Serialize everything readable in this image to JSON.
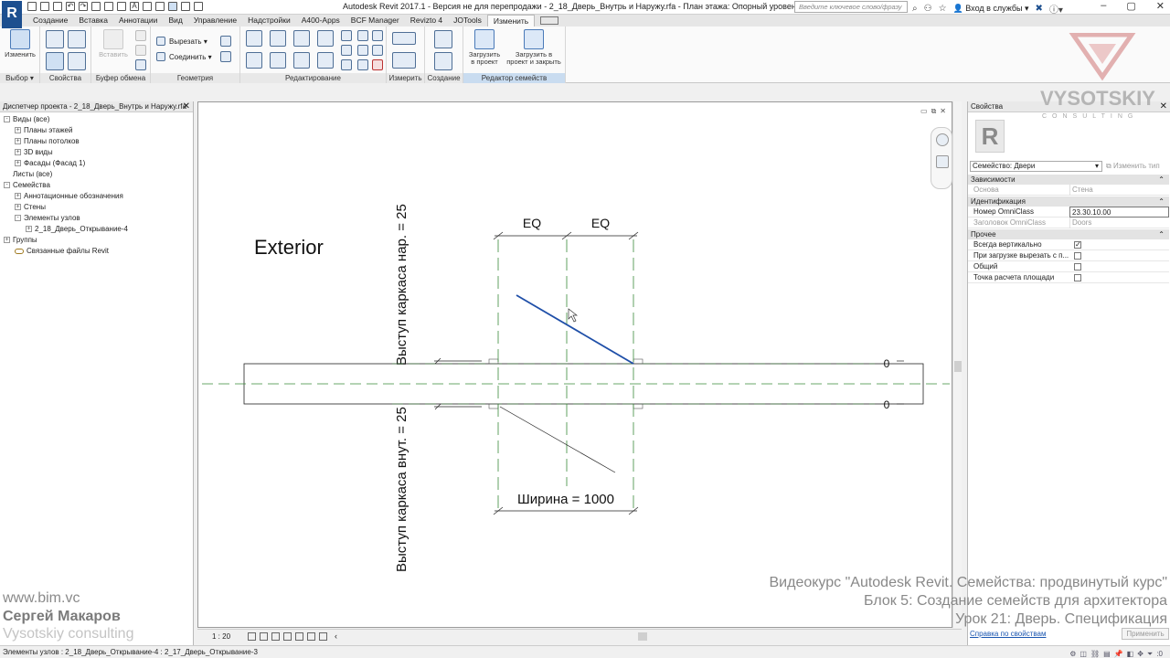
{
  "titlebar": {
    "app_title": "Autodesk Revit 2017.1 - Версия не для перепродажи -    2_18_Дверь_Внутрь и Наружу.rfa - План этажа: Опорный уровень",
    "search_placeholder": "Введите ключевое слово/фразу",
    "signin": "Вход в службы",
    "logo": "R"
  },
  "tabs": [
    "Создание",
    "Вставка",
    "Аннотации",
    "Вид",
    "Управление",
    "Надстройки",
    "A400-Apps",
    "BCF Manager",
    "Revizto 4",
    "JOTools",
    "Изменить"
  ],
  "active_tab": "Изменить",
  "ribbon": {
    "modify_label": "Изменить",
    "paste_label": "Вставить",
    "cut_label": "Вырезать",
    "join_label": "Соединить",
    "load_project_label": "Загрузить в проект",
    "load_close_label": "Загрузить в проект и закрыть",
    "groups": {
      "select": "Выбор",
      "properties": "Свойства",
      "clipboard": "Буфер обмена",
      "geometry": "Геометрия",
      "modify": "Редактирование",
      "measure": "Измерить",
      "create": "Создание",
      "family_editor": "Редактор семейств"
    }
  },
  "project_browser": {
    "title": "Диспетчер проекта - 2_18_Дверь_Внутрь и Наружу.rfa",
    "items": [
      {
        "label": "Виды (все)",
        "toggle": "-"
      },
      {
        "label": "Планы этажей",
        "toggle": "+"
      },
      {
        "label": "Планы потолков",
        "toggle": "+"
      },
      {
        "label": "3D виды",
        "toggle": "+"
      },
      {
        "label": "Фасады (Фасад 1)",
        "toggle": "+"
      },
      {
        "label": "Листы (все)",
        "toggle": ""
      },
      {
        "label": "Семейства",
        "toggle": "-"
      },
      {
        "label": "Аннотационные обозначения",
        "toggle": "+"
      },
      {
        "label": "Стены",
        "toggle": "+"
      },
      {
        "label": "Элементы узлов",
        "toggle": "-"
      },
      {
        "label": "2_18_Дверь_Открывание-4",
        "toggle": "+"
      },
      {
        "label": "Группы",
        "toggle": "+"
      },
      {
        "label": "Связанные файлы Revit",
        "toggle": ""
      }
    ]
  },
  "drawing": {
    "exterior_label": "Exterior",
    "eq_left": "EQ",
    "eq_right": "EQ",
    "width_dim": "Ширина = 1000",
    "frame_out_dim": "Выступ каркаса нар. = 25",
    "frame_in_dim": "Выступ каркаса внут. = 25",
    "zero_top": "0",
    "zero_bottom": "0"
  },
  "view_bar": {
    "scale": "1 : 20"
  },
  "properties": {
    "title": "Свойства",
    "thumb": "R",
    "family": "Семейство: Двери",
    "edit_type": "Изменить тип",
    "categories": {
      "constraints": "Зависимости",
      "identity": "Идентификация",
      "other": "Прочее"
    },
    "host_key": "Основа",
    "host_value": "Стена",
    "omni_num_key": "Номер OmniClass",
    "omni_num_value": "23.30.10.00",
    "omni_title_key": "Заголовок OmniClass",
    "omni_title_value": "Doors",
    "checks": [
      {
        "label": "Всегда вертикально",
        "checked": true
      },
      {
        "label": "При загрузке вырезать с п...",
        "checked": false
      },
      {
        "label": "Общий",
        "checked": false
      },
      {
        "label": "Точка расчета площади",
        "checked": false
      }
    ],
    "help_link": "Справка по свойствам",
    "apply": "Применить"
  },
  "status": {
    "text": "Элементы узлов : 2_18_Дверь_Открывание-4 : 2_17_Дверь_Открывание-3",
    "zero": ":0"
  },
  "watermark": {
    "brand": "VYSOTSKIY",
    "sub": "CONSULTING"
  },
  "course_overlay": {
    "line1": "Видеокурс \"Autodesk Revit. Семейства: продвинутый курс\"",
    "line2": "Блок 5: Создание семейств для архитектора",
    "line3": "Урок 21: Дверь. Спецификация"
  },
  "author_overlay": {
    "site": "www.bim.vc",
    "name": "Сергей Макаров",
    "company": "Vysotskiy consulting"
  },
  "colors": {
    "dim_green": "#3a8a3a",
    "door_blue": "#1f4fa8",
    "accent": "#1d4f8f"
  }
}
